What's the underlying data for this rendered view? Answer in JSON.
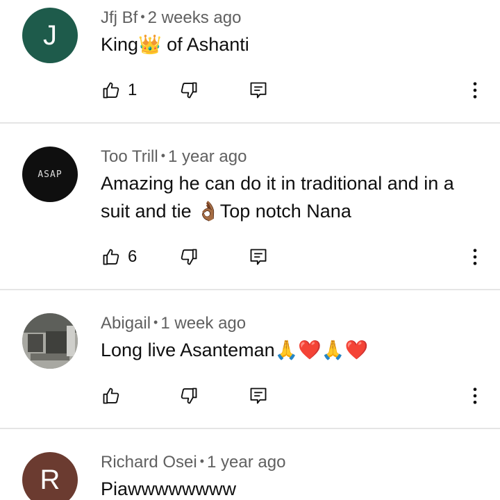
{
  "comments": [
    {
      "author": "Jfj Bf",
      "time": "2 weeks ago",
      "text": "King👑 of Ashanti",
      "likes": "1",
      "avatar_letter": "J",
      "avatar_color": "#1e5b4b"
    },
    {
      "author": "Too Trill",
      "time": "1 year ago",
      "text": "Amazing he can do it in traditional and in a suit and tie 👌🏾Top notch Nana",
      "likes": "6",
      "avatar_text": "ASAP",
      "avatar_color": "#0f0f0f"
    },
    {
      "author": "Abigail",
      "time": "1 week ago",
      "text": "Long live Asanteman🙏❤️🙏❤️",
      "likes": "",
      "avatar_color": "#8a8a86"
    },
    {
      "author": "Richard Osei",
      "time": "1 year ago",
      "text": "Piawwwwwwww",
      "avatar_letter": "R",
      "avatar_color": "#6b3b30"
    }
  ],
  "icons": {
    "like": "thumbs-up-icon",
    "dislike": "thumbs-down-icon",
    "reply": "reply-icon",
    "more": "more-vertical-icon"
  },
  "colors": {
    "meta_text": "#606060",
    "divider": "#e5e5e5"
  }
}
